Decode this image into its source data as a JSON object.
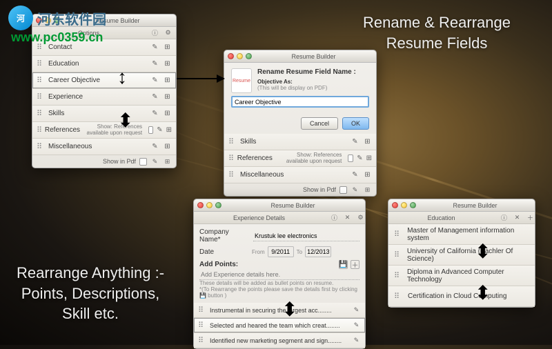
{
  "watermark": {
    "brand": "河东软件园",
    "url": "www.pc0359.cn"
  },
  "headlines": {
    "top": "Rename & Rearrange\nResume Fields",
    "bottom": "Rearrange Anything :-\nPoints, Descriptions,\nSkill etc."
  },
  "options_panel": {
    "window_title": "Resume Builder",
    "toolbar_title": "Options",
    "rows": [
      {
        "label": "Contact"
      },
      {
        "label": "Education"
      },
      {
        "label": "Career Objective",
        "selected": true
      },
      {
        "label": "Experience"
      },
      {
        "label": "Skills"
      },
      {
        "label": "References",
        "note": "Show: References available upon request",
        "checkbox": true
      },
      {
        "label": "Miscellaneous"
      }
    ],
    "footer_label": "Show in Pdf"
  },
  "rename_dialog": {
    "window_title": "Resume Builder",
    "icon_label": "Resume",
    "heading": "Rename Resume Field Name :",
    "subheading": "Objective As:",
    "hint": "(This will be display on PDF)",
    "value": "Career Objective",
    "cancel": "Cancel",
    "ok": "OK"
  },
  "lower_options": {
    "rows": [
      {
        "label": "Skills"
      },
      {
        "label": "References",
        "note": "Show: References available upon request",
        "checkbox": true
      },
      {
        "label": "Miscellaneous"
      }
    ],
    "footer_label": "Show in Pdf"
  },
  "experience_panel": {
    "window_title": "Resume Builder",
    "toolbar_title": "Experience Details",
    "company_label": "Company Name*",
    "company_value": "Krustuk lee electronics",
    "date_label": "Date",
    "date_from_label": "From",
    "date_from": "9/2011",
    "date_to_label": "To",
    "date_to": "12/2013",
    "add_points_label": "Add Points:",
    "placeholder": "Add Experience details here.",
    "hint1": "These details will be added as bullet points on resume.",
    "hint2": "*(To Rearrange the points please save the details first by clicking 💾 button )",
    "bullets": [
      "Instrumental in securing the largest acc........",
      "Selected and heared the team which creat........",
      "Identified new marketing segment and sign........"
    ]
  },
  "education_panel": {
    "window_title": "Resume Builder",
    "toolbar_title": "Education",
    "rows": [
      "Master of Management information system",
      "University of California (Bachler Of Science)",
      "Diploma in Advanced Computer Technology",
      "Certification in Cloud Computing"
    ]
  },
  "icons": {
    "info": "info-icon",
    "gear": "gear-icon",
    "grip": "grip-icon",
    "edit": "edit-icon",
    "grid": "grid-icon",
    "close": "close-icon",
    "add": "add-icon"
  }
}
